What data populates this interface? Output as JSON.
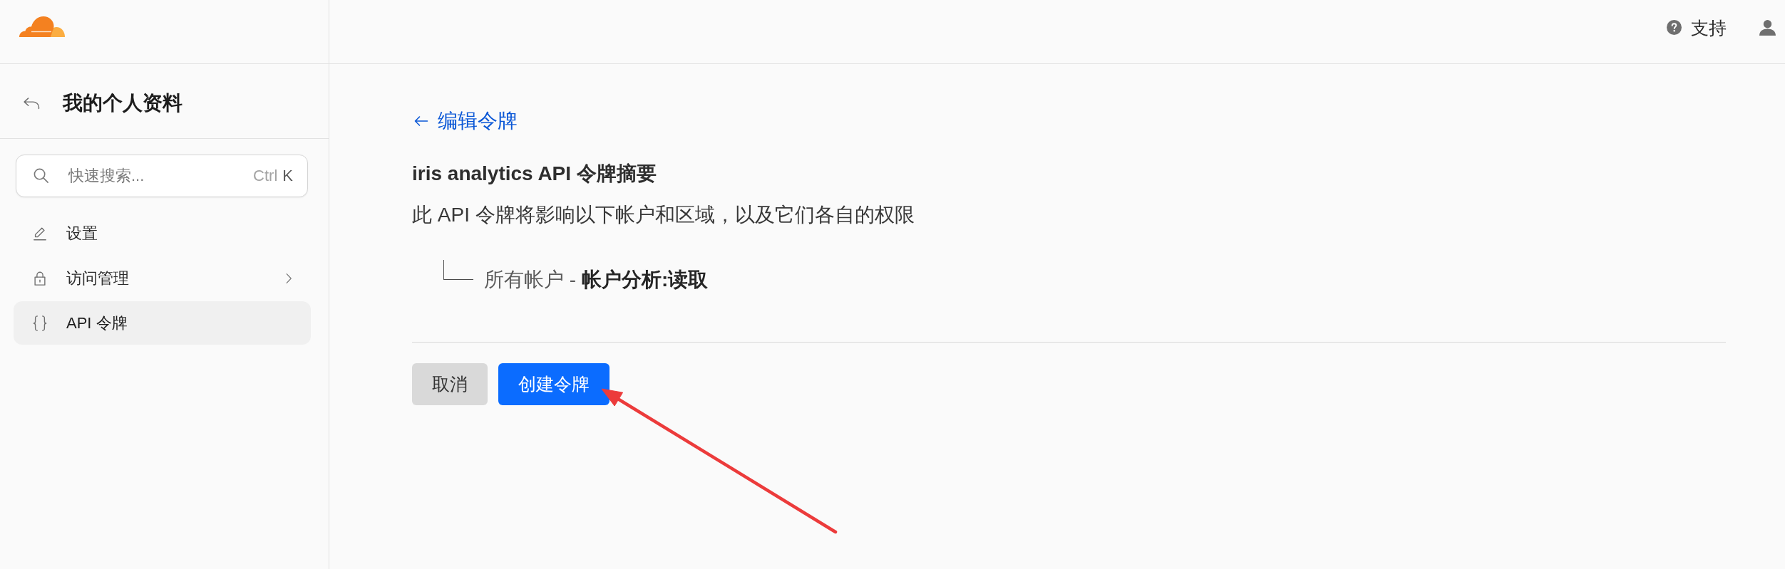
{
  "topbar": {
    "support_link": "支持"
  },
  "sidebar": {
    "title": "我的个人资料",
    "search": {
      "placeholder": "快速搜索...",
      "shortcut_keys": [
        "Ctrl",
        "K"
      ]
    },
    "items": [
      {
        "label": "设置",
        "kind": "page",
        "selected": false
      },
      {
        "label": "访问管理",
        "kind": "section",
        "selected": false
      },
      {
        "label": "API 令牌",
        "kind": "page",
        "selected": true
      }
    ]
  },
  "main": {
    "back_link": "编辑令牌",
    "title": "iris analytics API 令牌摘要",
    "description": "此 API 令牌将影响以下帐户和区域，以及它们各自的权限",
    "scopes": [
      {
        "text": "所有帐户 - **帐户分析:读取**"
      }
    ],
    "buttons": [
      {
        "label": "取消",
        "kind": "secondary"
      },
      {
        "label": "创建令牌",
        "kind": "primary"
      }
    ]
  }
}
